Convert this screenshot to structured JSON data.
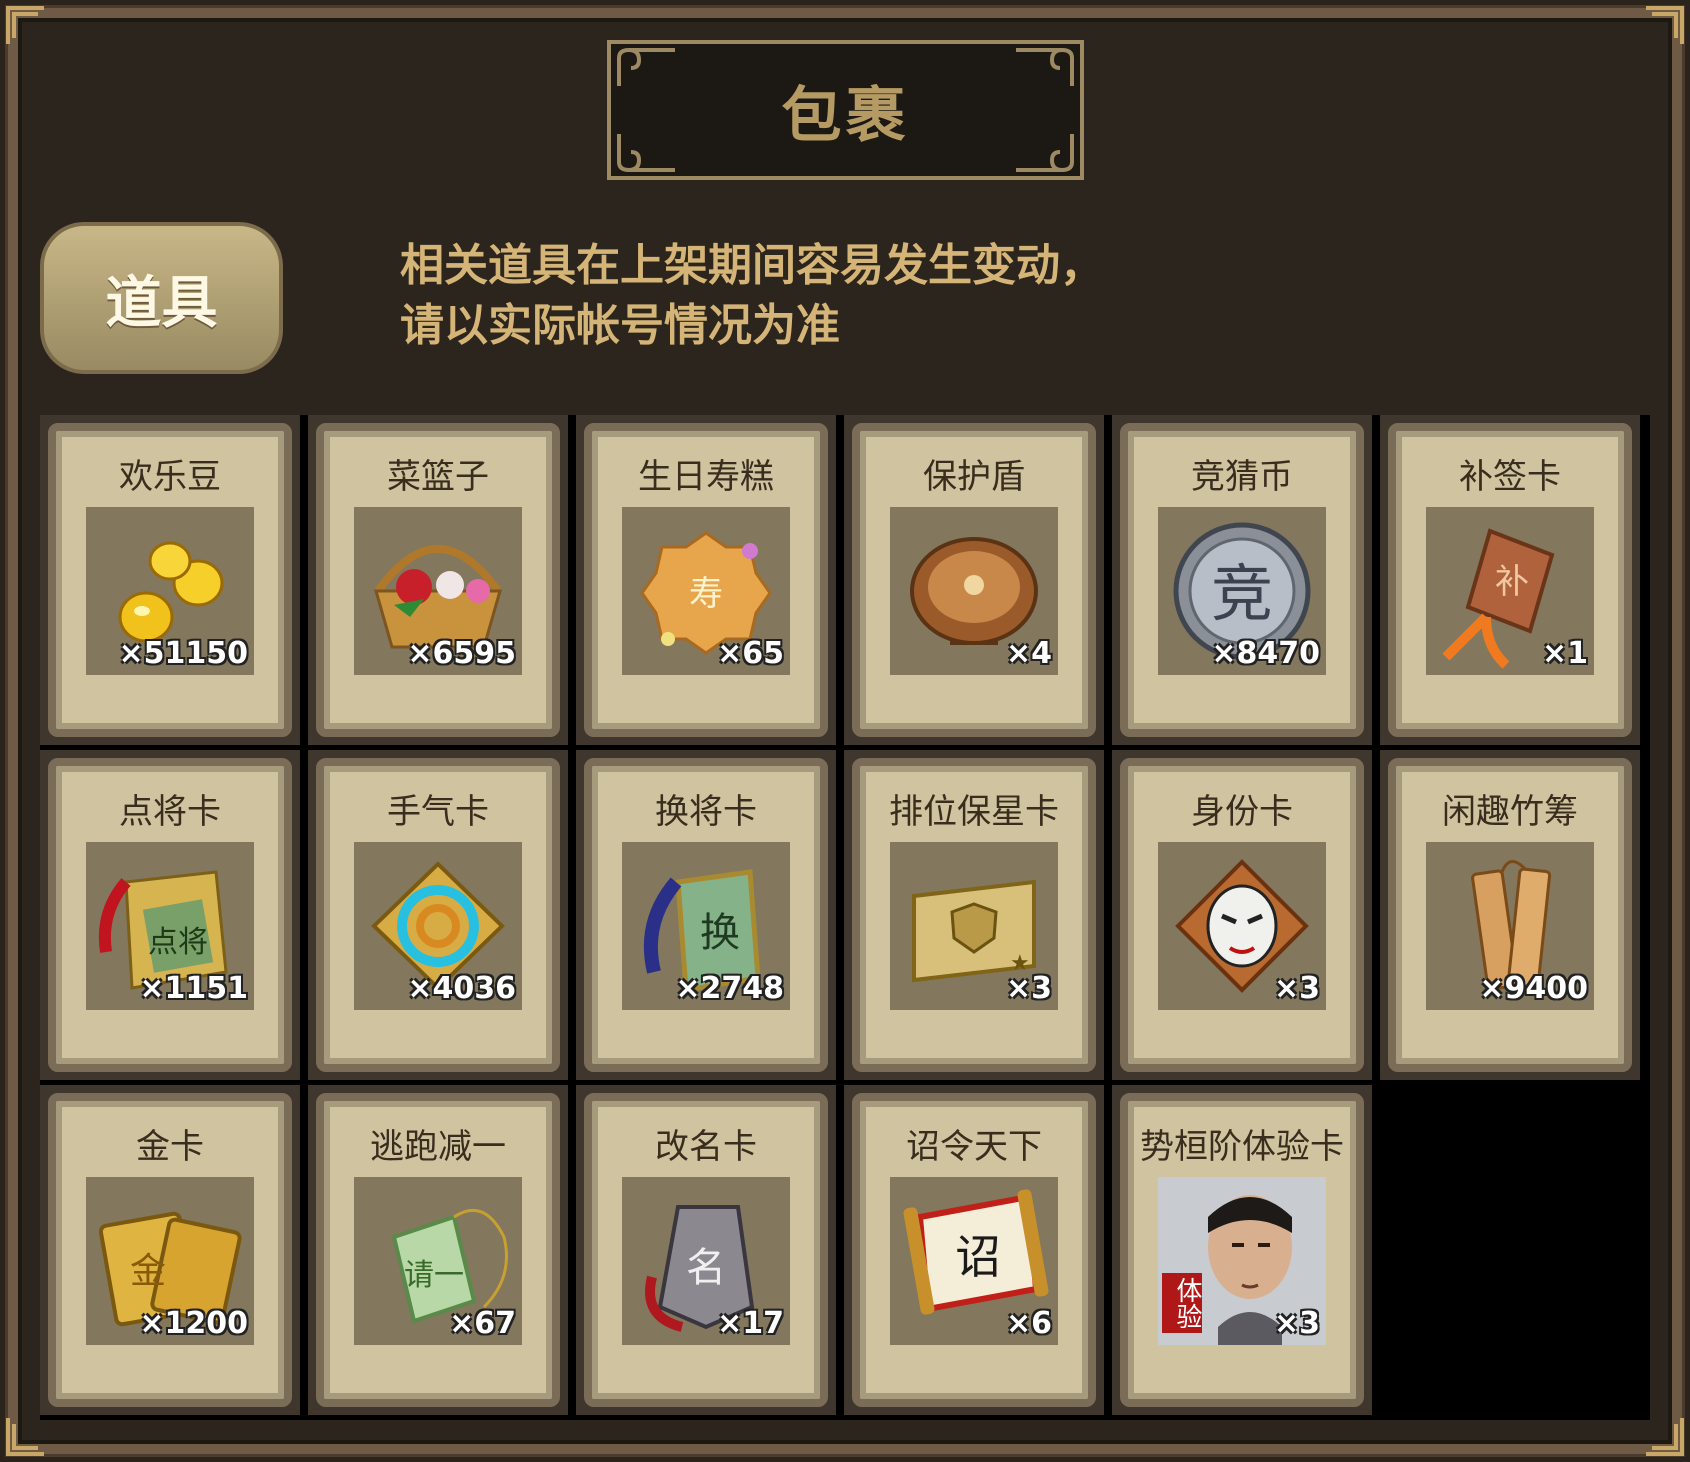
{
  "window": {
    "title": "包裹"
  },
  "tab": {
    "label": "道具"
  },
  "notice": {
    "line1": "相关道具在上架期间容易发生变动，",
    "line2": "请以实际帐号情况为准"
  },
  "items": [
    {
      "name": "欢乐豆",
      "qty": "×51150",
      "icon": "gold-beans-icon"
    },
    {
      "name": "菜篮子",
      "qty": "×6595",
      "icon": "flower-basket-icon"
    },
    {
      "name": "生日寿糕",
      "qty": "×65",
      "icon": "birthday-cake-icon"
    },
    {
      "name": "保护盾",
      "qty": "×4",
      "icon": "shield-icon"
    },
    {
      "name": "竞猜币",
      "qty": "×8470",
      "icon": "guess-coin-icon"
    },
    {
      "name": "补签卡",
      "qty": "×1",
      "icon": "sign-tag-icon"
    },
    {
      "name": "点将卡",
      "qty": "×1151",
      "icon": "general-card-icon"
    },
    {
      "name": "手气卡",
      "qty": "×4036",
      "icon": "luck-card-icon"
    },
    {
      "name": "换将卡",
      "qty": "×2748",
      "icon": "swap-card-icon"
    },
    {
      "name": "排位保星卡",
      "qty": "×3",
      "icon": "star-protect-card-icon"
    },
    {
      "name": "身份卡",
      "qty": "×3",
      "icon": "identity-mask-icon"
    },
    {
      "name": "闲趣竹筹",
      "qty": "×9400",
      "icon": "bamboo-token-icon"
    },
    {
      "name": "金卡",
      "qty": "×1200",
      "icon": "gold-card-icon"
    },
    {
      "name": "逃跑减一",
      "qty": "×67",
      "icon": "jade-tag-icon"
    },
    {
      "name": "改名卡",
      "qty": "×17",
      "icon": "rename-card-icon"
    },
    {
      "name": "诏令天下",
      "qty": "×6",
      "icon": "edict-scroll-icon"
    },
    {
      "name": "势桓阶体验卡",
      "qty": "×3",
      "icon": "hero-portrait-icon",
      "badge": "体验"
    }
  ]
}
